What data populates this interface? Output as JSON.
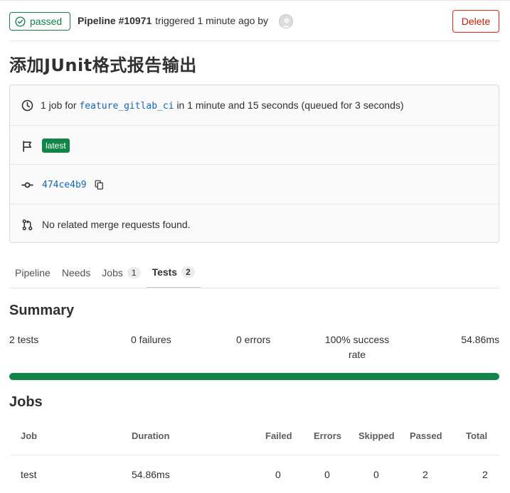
{
  "header": {
    "status": "passed",
    "pipeline": "Pipeline #10971",
    "triggered": "triggered 1 minute ago by",
    "delete_label": "Delete"
  },
  "title": "添加JUnit格式报告输出",
  "info": {
    "job_prefix": "1 job for",
    "branch": "feature_gitlab_ci",
    "job_suffix": "in 1 minute and 15 seconds (queued for 3 seconds)",
    "latest_badge": "latest",
    "commit": "474ce4b9",
    "merge_requests": "No related merge requests found."
  },
  "tabs": [
    {
      "label": "Pipeline"
    },
    {
      "label": "Needs"
    },
    {
      "label": "Jobs",
      "count": "1"
    },
    {
      "label": "Tests",
      "count": "2"
    }
  ],
  "summary": {
    "title": "Summary",
    "tests": "2 tests",
    "failures": "0 failures",
    "errors": "0 errors",
    "success_line1": "100% success",
    "success_line2": "rate",
    "duration": "54.86ms",
    "success_fraction": 1.0,
    "accent_color": "#108548"
  },
  "jobs": {
    "title": "Jobs",
    "headers": [
      "Job",
      "Duration",
      "Failed",
      "Errors",
      "Skipped",
      "Passed",
      "Total"
    ],
    "rows": [
      [
        "test",
        "54.86ms",
        "0",
        "0",
        "0",
        "2",
        "2"
      ]
    ]
  },
  "icons": [
    "check-circle-icon",
    "clock-icon",
    "flag-icon",
    "commit-icon",
    "copy-icon",
    "merge-request-icon"
  ]
}
